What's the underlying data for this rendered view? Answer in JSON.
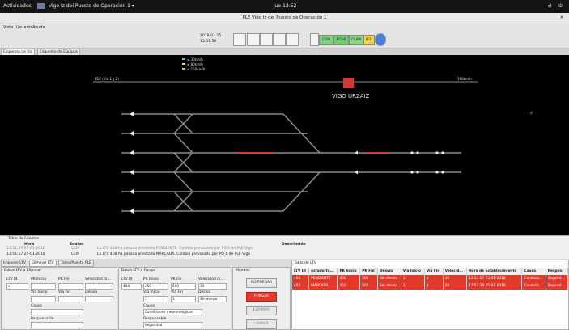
{
  "topbar": {
    "activities": "Actividades",
    "app_menu": "Vigo Iz del Puesto de Operación 1 ▾",
    "clock": "jue 13:52"
  },
  "window": {
    "title": "PLE Vigo Iz del Puesto de Operación 1"
  },
  "menu": {
    "items": [
      "Vista",
      "Usuario",
      "Ayuda"
    ]
  },
  "toolbar": {
    "datetime_date": "2018-01-25",
    "datetime_time": "13:51:59",
    "status_buttons": [
      "CEM",
      "PCI-R",
      "CLEM",
      "LEU"
    ]
  },
  "main_tabs": [
    "Esquema de Vía",
    "Esquema de Equipos"
  ],
  "canvas": {
    "legend": [
      "≤ 30km/h",
      "≤ 80km/h",
      "≤ 160km/h"
    ],
    "right_speed": "160km/h",
    "track_label": "EDF (Vía 1 y 2)",
    "station_name": "VIGO URZAIZ"
  },
  "events": {
    "title": "Tabla de Eventos",
    "headers": [
      "Hora",
      "Equipo",
      "Descripción"
    ],
    "rows": [
      {
        "hora": "13:51:57 25-01-2018",
        "equipo": "CEM",
        "desc": "La LTV 408 ha pasado al estado PENDIENTE. Cambio provocado por PO 1 de PLE Vigo"
      },
      {
        "hora": "13:51:57 25-01-2018",
        "equipo": "CEM",
        "desc": "La LTV 408 ha pasado al estado MARCADA. Cambio provocado por PO 1 de PLE Vigo"
      }
    ]
  },
  "bottom_tabs": [
    "Imponer LTV",
    "Eliminar LTV",
    "Toma/Puesta PLE"
  ],
  "delete_panel": {
    "title": "Datos LTV a Eliminar",
    "labels": [
      "LTV Id",
      "PK Inicio",
      "PK Fin",
      "Velocidad (k...",
      "Vía Inicio",
      "Vía Fin",
      "Desvío",
      "Causa",
      "Responsable"
    ]
  },
  "purge_panel": {
    "title": "Datos LTV a Purgar",
    "labels": [
      "LTV Id",
      "PK Inicio",
      "PK Fin",
      "Velocidad (k...",
      "Vía Inicio",
      "Vía Fin",
      "Desvío",
      "Causa",
      "Responsable"
    ],
    "values": {
      "ltv_id": "404",
      "pk_inicio": "450",
      "pk_fin": "500",
      "velocidad": "30",
      "via_inicio": "1",
      "via_fin": "1",
      "desvio": "Sin desvío",
      "causa": "Condiciones meteorológicas",
      "responsable": "Seguridad"
    }
  },
  "actions": {
    "title": "Mandos",
    "buttons": [
      "NO PURGAR",
      "PURGAR",
      "ELIMINAR",
      "LIMPIAR"
    ]
  },
  "ltv_table": {
    "title": "Tabla de LTV",
    "headers": [
      "LTV ID",
      "Estado To...",
      "PK Inicio",
      "PK Fin",
      "Desvío",
      "Vía Inicio",
      "Vía Fin",
      "Velocid...",
      "Hora de Establecimiento",
      "Causa",
      "Respon"
    ],
    "rows": [
      [
        "404",
        "PENDIENTE",
        "450",
        "500",
        "Sin desvío",
        "1",
        "1",
        "30",
        "13:51:57 25-01-2018",
        "Condicio...",
        "Segurid..."
      ],
      [
        "403",
        "MARCADA",
        "450",
        "500",
        "Sin desvío",
        "1",
        "1",
        "30",
        "13:51:39 25-01-2018",
        "Condicio...",
        "Segurid..."
      ]
    ]
  },
  "colors": {
    "accent_red": "#e23a2a",
    "canvas_bg": "#000000",
    "track": "#8a8a8a"
  }
}
